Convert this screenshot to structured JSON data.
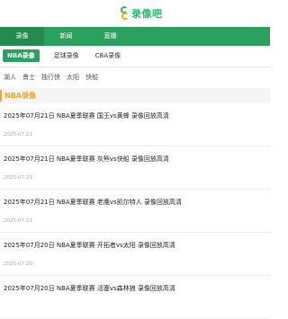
{
  "header": {
    "logo_text": "录像吧"
  },
  "nav": [
    {
      "label": "录像"
    },
    {
      "label": "新闻"
    },
    {
      "label": "直播"
    }
  ],
  "subtabs": [
    {
      "label": "NBA录像"
    },
    {
      "label": "足球录像"
    },
    {
      "label": "CBA录像"
    }
  ],
  "teams": [
    "湖人",
    "勇士",
    "独行侠",
    "太阳",
    "快船"
  ],
  "section": {
    "title": "NBA录像"
  },
  "items": [
    {
      "title": "2025年07月21日 NBA夏季联赛 国王vs黄蜂 录像回放高清",
      "date": "2025-07-21"
    },
    {
      "title": "2025年07月21日 NBA夏季联赛 灰熊vs快船 录像回放高清",
      "date": "2025-07-21"
    },
    {
      "title": "2025年07月21日 NBA夏季联赛 老鹰vs凯尔特人 录像回放高清",
      "date": "2025-07-21"
    },
    {
      "title": "2025年07月20日 NBA夏季联赛 开拓者vs太阳 录像回放高清",
      "date": "2025-07-20"
    },
    {
      "title": "2025年07月20日 NBA夏季联赛 活塞vs森林狼 录像回放高清",
      "date": ""
    }
  ],
  "colors": {
    "brand_green": "#2ba160",
    "accent_orange": "#f5a623"
  }
}
